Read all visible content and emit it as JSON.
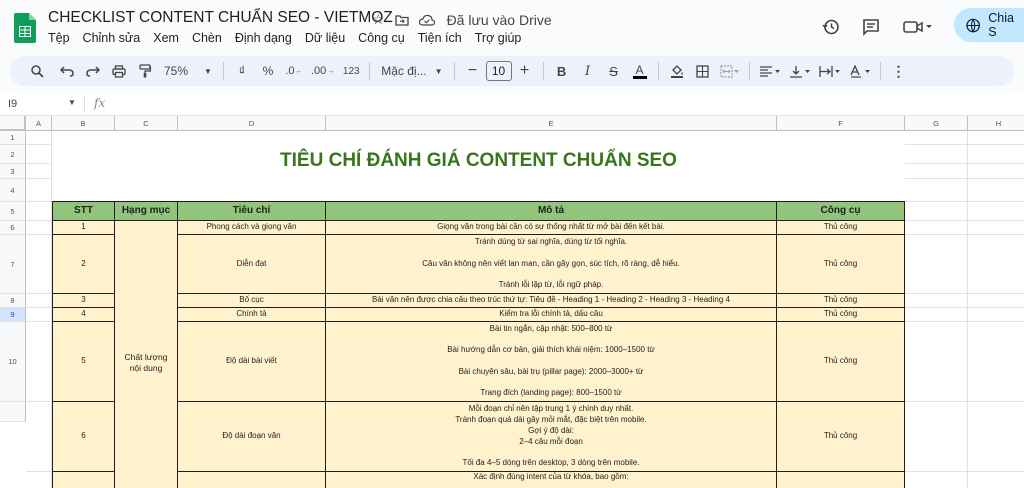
{
  "app": {
    "title": "CHECKLIST CONTENT CHUẨN SEO - VIETMOZ",
    "saved_status": "Đã lưu vào Drive",
    "share_label": "Chia S"
  },
  "menu": [
    "Tệp",
    "Chỉnh sửa",
    "Xem",
    "Chèn",
    "Định dạng",
    "Dữ liệu",
    "Công cụ",
    "Tiện ích",
    "Trợ giúp"
  ],
  "toolbar": {
    "zoom": "75%",
    "currency": "₫",
    "percent": "%",
    "dec_decrease": ".0",
    "dec_increase": ".00",
    "number_format": "123",
    "font": "Mặc đị...",
    "font_size": "10",
    "bold": "B",
    "italic": "I",
    "strike": "S",
    "text_color": "A",
    "minus": "−",
    "plus": "+"
  },
  "formula_bar": {
    "cell_ref": "I9",
    "fx": "fx",
    "value": ""
  },
  "columns": [
    "A",
    "B",
    "C",
    "D",
    "E",
    "F",
    "G",
    "H"
  ],
  "rows": [
    "1",
    "2",
    "3",
    "4",
    "5",
    "6",
    "7",
    "8",
    "9",
    "10"
  ],
  "sheet": {
    "title": "TIÊU CHÍ ĐÁNH GIÁ CONTENT CHUẨN SEO",
    "headers": {
      "stt": "STT",
      "category": "Hạng mục",
      "criteria": "Tiêu chí",
      "description": "Mô tả",
      "tool": "Công cụ"
    },
    "category_merged": "Chất lượng\nnội dung",
    "items": [
      {
        "stt": "1",
        "criteria": "Phong cách và giọng văn",
        "description": "Giọng văn trong bài cần có sự thống nhất từ mở bài đến kết bài.",
        "tool": "Thủ công"
      },
      {
        "stt": "2",
        "criteria": "Diễn đạt",
        "description": "Tránh dùng từ sai nghĩa, dùng từ tối nghĩa.\n\nCâu văn không nên viết lan man, cần gãy gọn, súc tích, rõ ràng, dễ hiểu.\n\nTránh lỗi lặp từ, lỗi ngữ pháp.",
        "tool": "Thủ công"
      },
      {
        "stt": "3",
        "criteria": "Bố cục",
        "description": "Bài văn nên được chia cấu theo trúc thứ tự: Tiêu đề - Heading 1 - Heading 2 - Heading 3 - Heading 4",
        "tool": "Thủ công"
      },
      {
        "stt": "4",
        "criteria": "Chính tả",
        "description": "Kiểm tra lỗi chính tả, dấu câu",
        "tool": "Thủ công"
      },
      {
        "stt": "5",
        "criteria": "Độ dài bài viết",
        "description": "Bài tin ngắn, cập nhật: 500–800 từ\n\nBài hướng dẫn cơ bản, giải thích khái niệm: 1000–1500 từ\n\nBài chuyên sâu, bài trụ (pillar page): 2000–3000+ từ\n\nTrang đích (landing page): 800–1500 từ",
        "tool": "Thủ công"
      },
      {
        "stt": "6",
        "criteria": "Độ dài đoạn văn",
        "description": "Mỗi đoạn chỉ nên tập trung 1 ý chính duy nhất.\nTránh đoạn quá dài gây mỏi mắt, đặc biệt trên mobile.\nGợi ý độ dài:\n2–4 câu mỗi đoạn\n\nTối đa 4–5 dòng trên desktop, 3 dòng trên mobile.",
        "tool": "Thủ công"
      },
      {
        "stt": "",
        "criteria": "",
        "description": "Xác định đúng intent của từ khóa, bao gồm:",
        "tool": ""
      }
    ]
  }
}
